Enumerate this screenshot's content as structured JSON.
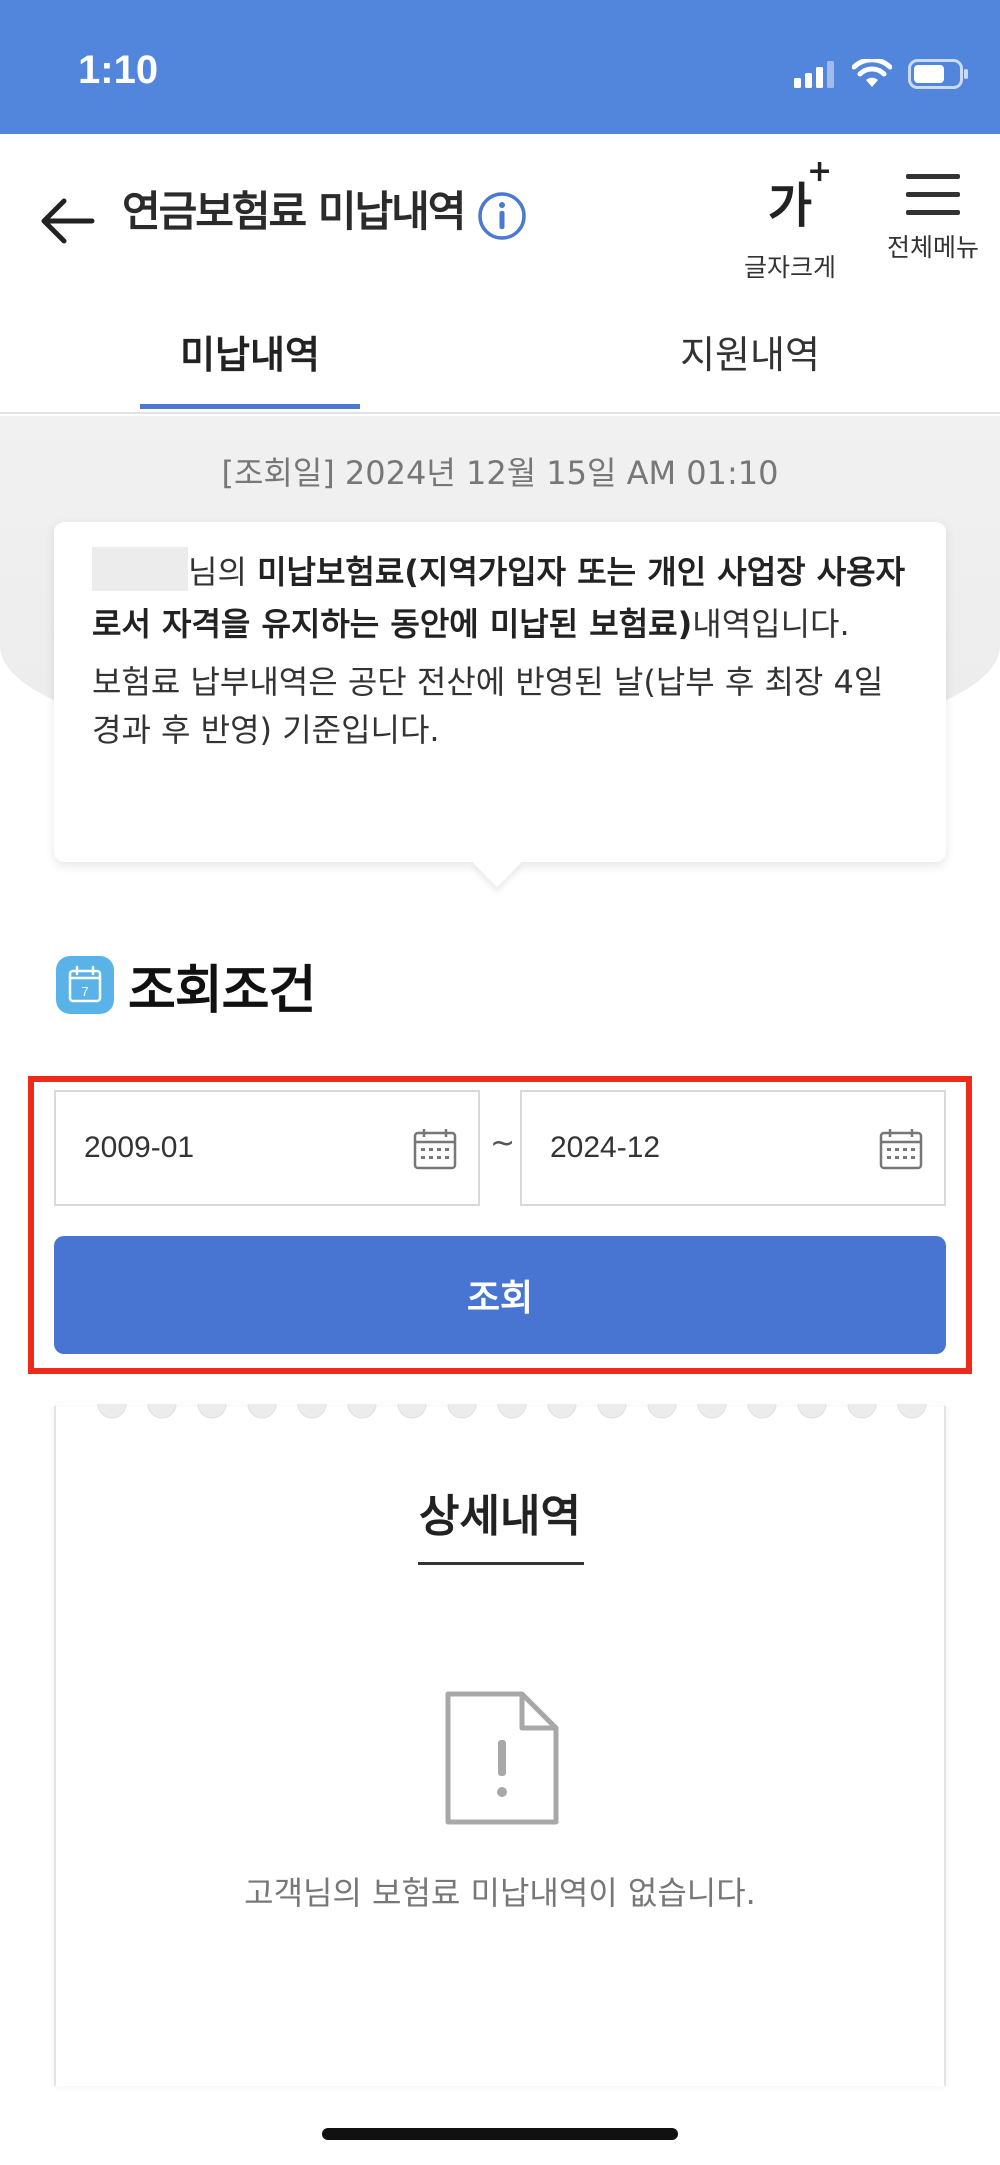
{
  "status_bar": {
    "time": "1:10"
  },
  "header": {
    "back_icon": "arrow-left-icon",
    "title": "연금보험료 미납내역",
    "info_icon": "info-icon",
    "font_size_button": {
      "glyph": "가",
      "plus": "+",
      "label": "글자크게"
    },
    "menu_button": {
      "icon": "hamburger-icon",
      "label": "전체메뉴"
    }
  },
  "tabs": [
    {
      "label": "미납내역",
      "active": true
    },
    {
      "label": "지원내역",
      "active": false
    }
  ],
  "query_date": "[조회일] 2024년 12월 15일 AM 01:10",
  "notice": {
    "name_suffix": "님의 ",
    "bold_text": "미납보험료(지역가입자 또는 개인 사업장 사용자로서 자격을 유지하는 동안에 미납된 보험료)",
    "tail_text": "내역입니다.",
    "paragraph2": "보험료 납부내역은 공단 전산에 반영된 날(납부 후 최장 4일 경과 후 반영) 기준입니다."
  },
  "conditions": {
    "icon": "calendar-icon",
    "badge_day": "7",
    "title": "조회조건",
    "from_date": "2009-01",
    "separator": "~",
    "to_date": "2024-12",
    "search_label": "조회"
  },
  "details": {
    "title": "상세내역",
    "empty_icon": "document-alert-icon",
    "empty_message": "고객님의 보험료 미납내역이 없습니다."
  },
  "colors": {
    "status_bar": "#5186dc",
    "accent": "#4874d2",
    "highlight": "#ee2a1a"
  }
}
